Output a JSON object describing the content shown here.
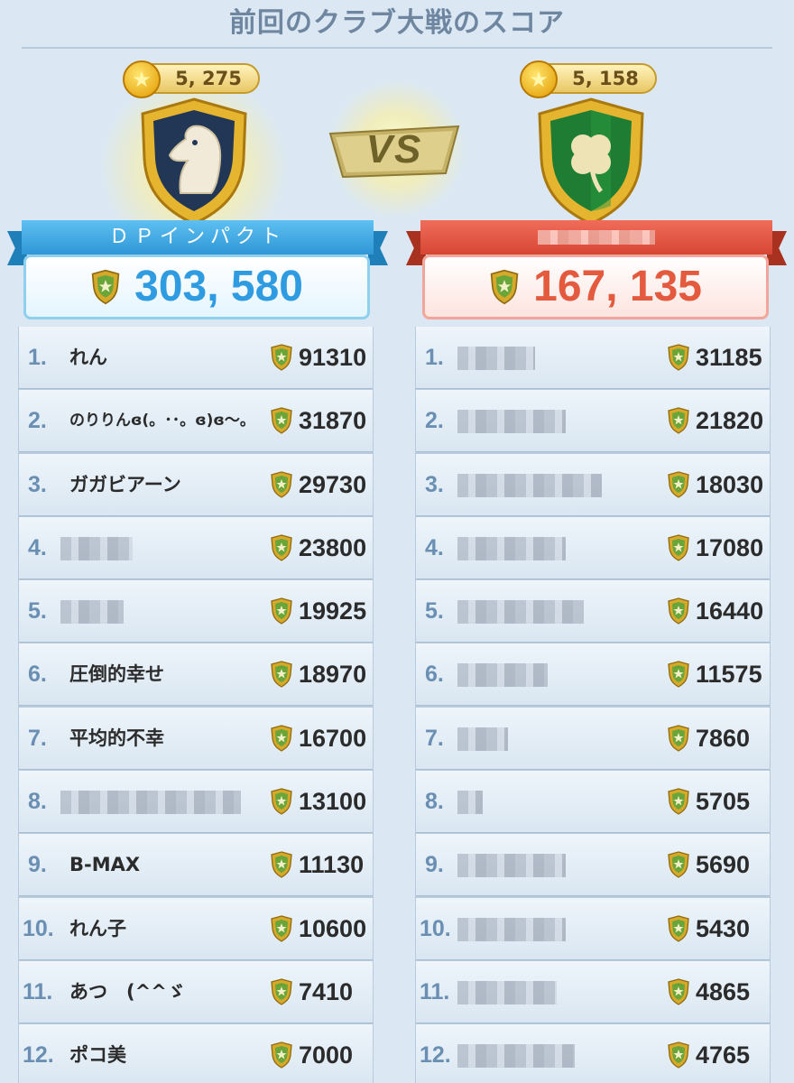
{
  "title": "前回のクラブ大戦のスコア",
  "vs_label": "VS",
  "left_club": {
    "stars": "5, 275",
    "name": "ＤＰインパクト",
    "total": "303, 580",
    "crest_icon": "horse-knight-icon",
    "color": "#2f9be0"
  },
  "right_club": {
    "stars": "5, 158",
    "name": "",
    "total": "167, 135",
    "crest_icon": "clover-icon",
    "color": "#e35a3e"
  },
  "left_members": [
    {
      "rank": "1.",
      "name": "れん",
      "score": "91310"
    },
    {
      "rank": "2.",
      "name": "のりりんɞ(。･･。ɞ)ɞ～。",
      "score": "31870"
    },
    {
      "rank": "3.",
      "name": "ガガビアーン",
      "score": "29730"
    },
    {
      "rank": "4.",
      "name": "",
      "score": "23800"
    },
    {
      "rank": "5.",
      "name": "",
      "score": "19925"
    },
    {
      "rank": "6.",
      "name": "圧倒的幸せ",
      "score": "18970"
    },
    {
      "rank": "7.",
      "name": "平均的不幸",
      "score": "16700"
    },
    {
      "rank": "8.",
      "name": "",
      "score": "13100"
    },
    {
      "rank": "9.",
      "name": "B-MAX",
      "score": "11130"
    },
    {
      "rank": "10.",
      "name": "れん子",
      "score": "10600"
    },
    {
      "rank": "11.",
      "name": "あつ　(^^ゞ",
      "score": "7410"
    },
    {
      "rank": "12.",
      "name": "ポコ美",
      "score": "7000"
    }
  ],
  "right_members": [
    {
      "rank": "1.",
      "name": "",
      "score": "31185"
    },
    {
      "rank": "2.",
      "name": "",
      "score": "21820"
    },
    {
      "rank": "3.",
      "name": "",
      "score": "18030"
    },
    {
      "rank": "4.",
      "name": "",
      "score": "17080"
    },
    {
      "rank": "5.",
      "name": "",
      "score": "16440"
    },
    {
      "rank": "6.",
      "name": "",
      "score": "11575"
    },
    {
      "rank": "7.",
      "name": "",
      "score": "7860"
    },
    {
      "rank": "8.",
      "name": "",
      "score": "5705"
    },
    {
      "rank": "9.",
      "name": "",
      "score": "5690"
    },
    {
      "rank": "10.",
      "name": "",
      "score": "5430"
    },
    {
      "rank": "11.",
      "name": "",
      "score": "4865"
    },
    {
      "rank": "12.",
      "name": "",
      "score": "4765"
    }
  ]
}
